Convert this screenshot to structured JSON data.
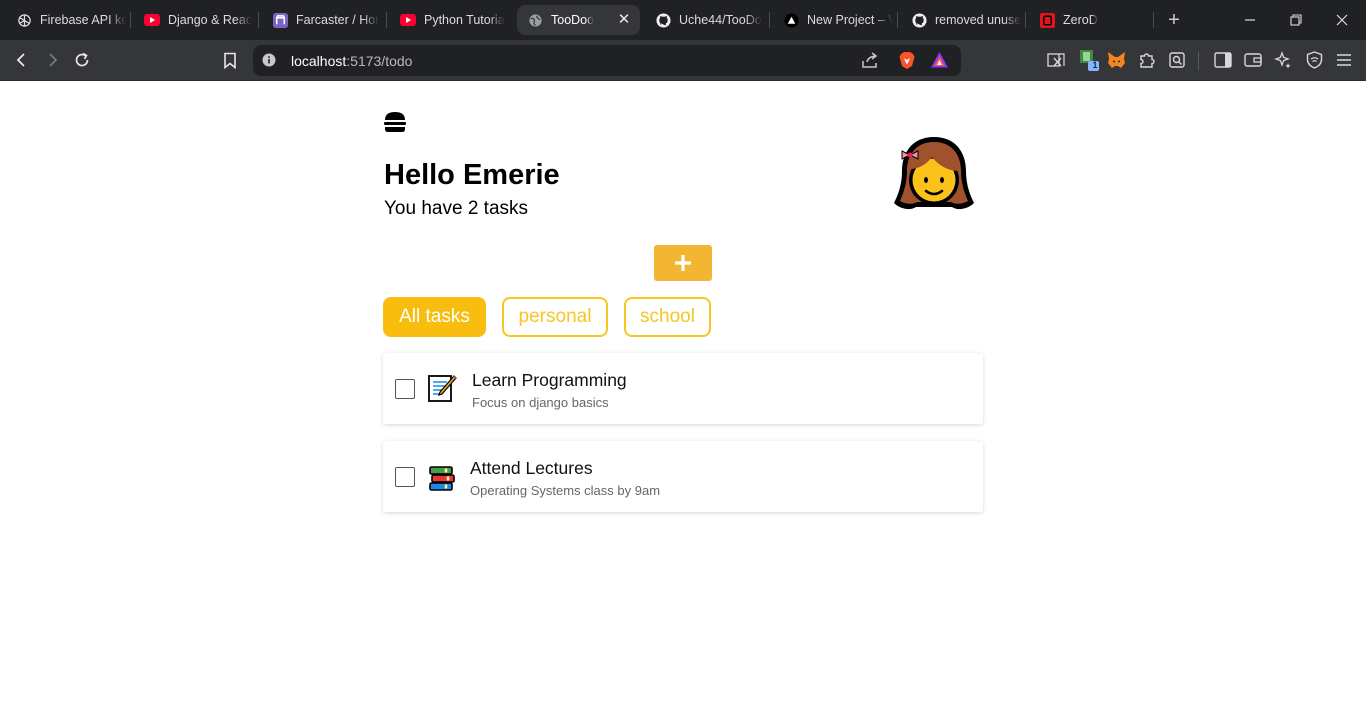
{
  "browser": {
    "tabs": [
      {
        "title": "Firebase API ke",
        "icon": "openai-icon"
      },
      {
        "title": "Django & Reac",
        "icon": "youtube-icon"
      },
      {
        "title": "Farcaster / Hor",
        "icon": "farcaster-icon"
      },
      {
        "title": "Python Tutoria",
        "icon": "youtube-icon"
      },
      {
        "title": "TooDoo",
        "icon": "globe-icon",
        "active": true
      },
      {
        "title": "Uche44/TooDo",
        "icon": "github-icon"
      },
      {
        "title": "New Project – V",
        "icon": "vercel-icon"
      },
      {
        "title": "removed unuse",
        "icon": "github-icon"
      },
      {
        "title": "ZeroD",
        "icon": "zerod-icon"
      }
    ],
    "tab_close": "✕",
    "new_tab": "+",
    "url": {
      "host": "localhost",
      "path": ":5173/todo"
    },
    "extension_badge": "1"
  },
  "app": {
    "greeting": "Hello Emerie",
    "subtitle": "You have 2 tasks",
    "add_button_label": "+",
    "filters": [
      {
        "label": "All tasks",
        "active": true
      },
      {
        "label": "personal",
        "active": false
      },
      {
        "label": "school",
        "active": false
      }
    ],
    "tasks": [
      {
        "title": "Learn Programming",
        "description": "Focus on django basics",
        "emoji": "memo-icon",
        "done": false
      },
      {
        "title": "Attend Lectures",
        "description": "Operating Systems class by 9am",
        "emoji": "books-icon",
        "done": false
      }
    ]
  },
  "colors": {
    "accent": "#f8bd0e",
    "add_button": "#f2b632",
    "chip_outline": "#f7c623"
  }
}
